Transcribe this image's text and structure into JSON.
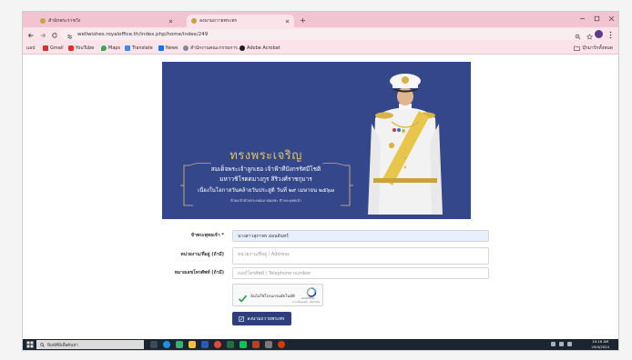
{
  "browser": {
    "tabs": [
      {
        "title": "สำนักพระราชวัง"
      },
      {
        "title": "ลงนามถวายพระพร"
      }
    ],
    "url": "wellwishes.royaloffice.th/index.php/home/index/249"
  },
  "bookmarks": {
    "items": [
      {
        "label": "แอป",
        "icon": "apps-icon"
      },
      {
        "label": "Gmail",
        "icon": "gmail-icon"
      },
      {
        "label": "YouTube",
        "icon": "youtube-icon"
      },
      {
        "label": "Maps",
        "icon": "maps-icon"
      },
      {
        "label": "Translate",
        "icon": "translate-icon"
      },
      {
        "label": "News",
        "icon": "news-icon"
      },
      {
        "label": "สำนักงานคณะกรรมการ...",
        "icon": "globe-icon"
      },
      {
        "label": "Adobe Acrobat",
        "icon": "acrobat-icon"
      }
    ],
    "all_label": "บุ๊กมาร์กทั้งหมด"
  },
  "banner": {
    "title": "ทรงพระเจริญ",
    "line1": "สมเด็จพระเจ้าลูกเธอ เจ้าฟ้าทีปังกรรัศมีโชติ",
    "line2": "มหาวชิโรตตมางกูร สิริวงศ์ราชกุมาร",
    "line3": "เนื่องในโอกาสวันคล้ายวันประสูติ วันที่ ๒๙ เมษายน ๒๕๖๗",
    "footnote": "ด้วยเกล้าด้วยกระหม่อม ขอเดชะ ข้าพระพุทธเจ้า"
  },
  "form": {
    "name": {
      "label": "ข้าพระพุทธเจ้า *",
      "value": "นางสาวสุภาพร อ่อนจันทร์"
    },
    "address": {
      "label": "หน่วยงาน/ที่อยู่ (ถ้ามี)",
      "placeholder": "หน่วยงาน/ที่อยู่ / Address"
    },
    "phone": {
      "label": "หมายเลขโทรศัพท์ (ถ้ามี)",
      "placeholder": "เบอร์โทรศัพท์ / Telephone number"
    },
    "captcha": {
      "label": "ฉันไม่ใช่โปรแกรมอัตโนมัติ",
      "brand": "reCAPTCHA",
      "terms": "ความเป็นส่วนตัว - ข้อกำหนด"
    },
    "submit_label": "ลงนามถวายพระพร"
  },
  "taskbar": {
    "search_placeholder": "พิมพ์ที่นี่เพื่อค้นหา",
    "time": "10:16 AM",
    "date": "29/4/2024"
  },
  "colors": {
    "tabbar": "#f2c4d1",
    "toolbar": "#fbe3ea",
    "banner_bg": "#34478a",
    "gold": "#e2c167",
    "button": "#2e3f7c",
    "autofill": "#e8f0fe",
    "taskbar": "#1b2530"
  }
}
